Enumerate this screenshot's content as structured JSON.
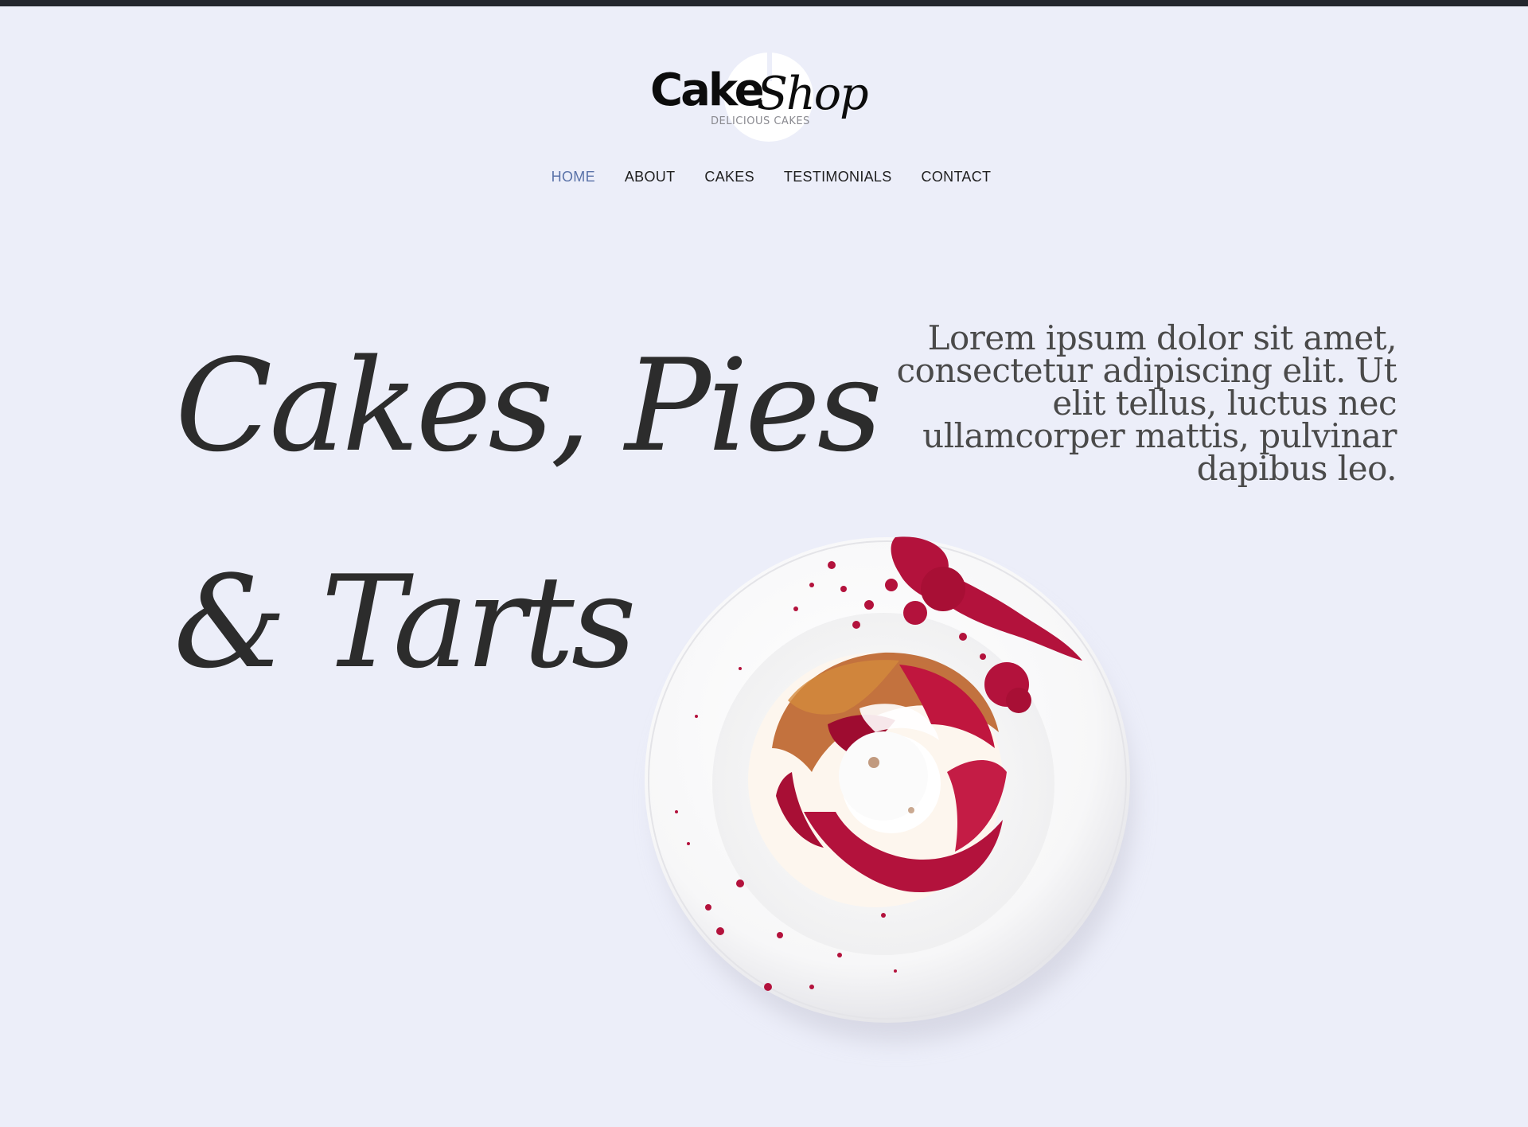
{
  "brand": {
    "name_part1": "Cake",
    "name_part2": "Shop",
    "tagline": "DELICIOUS CAKES"
  },
  "nav": {
    "items": [
      {
        "label": "HOME",
        "active": true
      },
      {
        "label": "ABOUT",
        "active": false
      },
      {
        "label": "CAKES",
        "active": false
      },
      {
        "label": "TESTIMONIALS",
        "active": false
      },
      {
        "label": "CONTACT",
        "active": false
      }
    ]
  },
  "hero": {
    "heading_line1": "Cakes, Pies",
    "heading_line2": "& Tarts",
    "intro": "Lorem ipsum dolor sit amet, consectetur adipiscing elit. Ut elit tellus, luctus nec ullamcorper mattis, pulvinar dapibus leo."
  },
  "colors": {
    "background": "#eceef9",
    "accent": "#5a72a8",
    "text": "#2c2c2c",
    "topbar": "#23262d",
    "berry": "#b3123c"
  },
  "icons": {
    "plate_image": "cake-on-plate-image"
  }
}
